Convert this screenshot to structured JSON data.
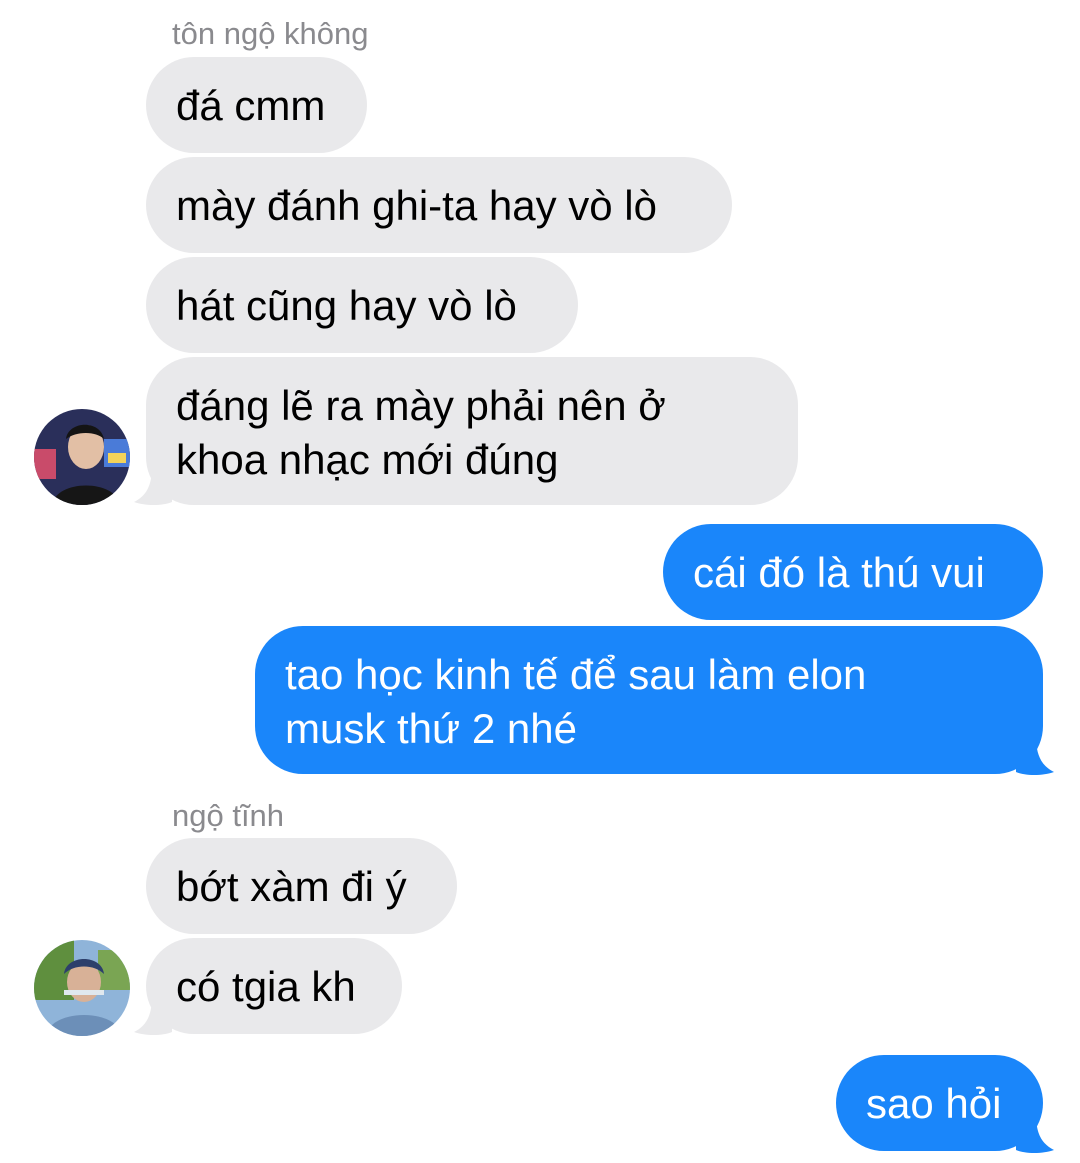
{
  "conversation": {
    "group1": {
      "sender_name": "tôn ngộ không",
      "messages": [
        "đá cmm",
        "mày đánh ghi-ta hay vò lò",
        "hát cũng hay vò lò",
        "đáng lẽ ra mày phải nên ở\nkhoa nhạc mới đúng"
      ]
    },
    "outgoing1": {
      "messages": [
        "cái đó là thú vui",
        "tao học kinh tế để sau làm elon\nmusk thứ 2 nhé"
      ]
    },
    "group2": {
      "sender_name": "ngộ tĩnh",
      "messages": [
        "bớt xàm đi ý",
        "có tgia kh"
      ]
    },
    "outgoing2": {
      "messages": [
        "sao hỏi"
      ]
    }
  },
  "colors": {
    "incoming_bubble": "#e9e9eb",
    "outgoing_bubble": "#1a86fa",
    "sender_name": "#8a8a8e"
  }
}
